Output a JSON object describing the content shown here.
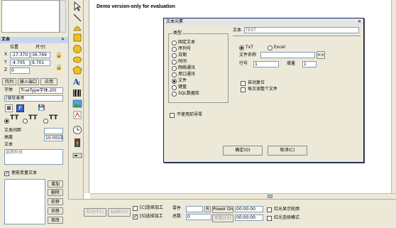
{
  "eval_banner": "Demo version-only for evaluation",
  "left_panel": {
    "title": "文本",
    "pos_label": "位置",
    "size_label": "尺寸(",
    "x_label": "X",
    "y_label": "Y",
    "z_label": "Z",
    "x_value": "-17.370",
    "w_value": "36.769",
    "y_value": "-4.705",
    "h_value": "9.701",
    "z_value": "0",
    "tab_array": "阵列",
    "tab_input": "输入端口",
    "tab_apply": "应用",
    "font_label": "字体",
    "font_value": "TrueType字体-20(",
    "font_name": "[微软雅黑",
    "spacing_label": "文本间距",
    "height_label": "高度",
    "height_value": "10.001毫",
    "text_label": "文本",
    "text_value": "晶辰科技",
    "var_text_label": "使能变量文本",
    "btn_add": "增加",
    "btn_delete": "删除",
    "btn_forward": "前移",
    "btn_back": "后移",
    "btn_modify": "修改"
  },
  "dialog": {
    "title": "文本元素",
    "type_group": "类型",
    "types": [
      "固定文本",
      "序列号",
      "日期",
      "时间",
      "网络通讯",
      "串口通讯",
      "文件",
      "键盘",
      "SQL数据库"
    ],
    "selected_type": "文件",
    "no_leading_zero": "不使用前导零",
    "text_label": "文本",
    "text_value": "TEST",
    "file_type_txt": "TxT",
    "file_type_excel": "Excel",
    "file_name_label": "文件名称",
    "browse_label": ">>",
    "row_label": "行号",
    "row_value": "1",
    "increment_label": "增量",
    "increment_value": "1",
    "auto_reset": "自动复位",
    "read_whole": "每次读整个文件",
    "ok": "确定(O)",
    "cancel": "取消(C)"
  },
  "bottom": {
    "red_light": "红光(F1)",
    "mark": "标刻(F2)",
    "continuous": "[C]连续加工",
    "select_process": "[S]选择加工",
    "part_label": "零件",
    "part_value": "",
    "total_label": "总数",
    "total_value": "0",
    "r_label": "R",
    "power_label": "Power On",
    "time1": "00:00:00",
    "param_btn": "参数(F3)",
    "time2": "00:00:00",
    "red_outline": "红光显示轮廓",
    "red_continuous": "红光连续模式"
  }
}
